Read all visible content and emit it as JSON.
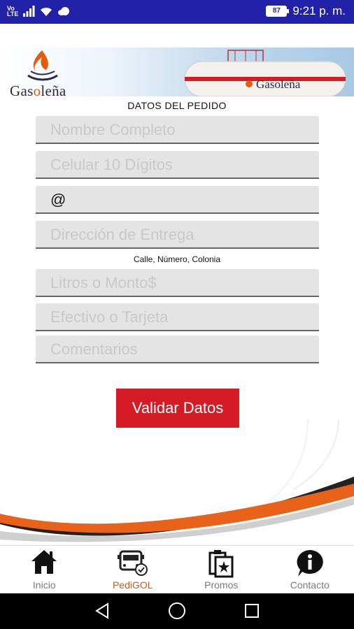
{
  "status_bar": {
    "volte": "VoLTE",
    "battery": "87",
    "time": "9:21 p. m."
  },
  "header": {
    "logo_text_pre": "Gas",
    "logo_text_o": "o",
    "logo_text_post": "leña"
  },
  "form": {
    "title": "DATOS DEL  PEDIDO",
    "fields": [
      {
        "placeholder": "Nombre Completo",
        "value": ""
      },
      {
        "placeholder": "Celular 10 Dígitos",
        "value": ""
      },
      {
        "placeholder": "",
        "value": "@"
      },
      {
        "placeholder": "Dirección de Entrega",
        "value": ""
      },
      {
        "placeholder": "Litros o Monto$",
        "value": ""
      },
      {
        "placeholder": "Efectivo o Tarjeta",
        "value": ""
      },
      {
        "placeholder": "Comentarios",
        "value": ""
      }
    ],
    "address_hint": "Calle, Número, Colonia",
    "submit_label": "Validar Datos"
  },
  "bottom_nav": {
    "items": [
      {
        "label": "Inicio",
        "icon": "home-icon"
      },
      {
        "label": "PediGOL",
        "icon": "truck-order-icon",
        "active": true
      },
      {
        "label": "Promos",
        "icon": "promos-icon"
      },
      {
        "label": "Contacto",
        "icon": "info-icon"
      }
    ]
  },
  "colors": {
    "status_bar": "#2222a8",
    "accent_red": "#d51b25",
    "accent_orange": "#d35a12"
  }
}
